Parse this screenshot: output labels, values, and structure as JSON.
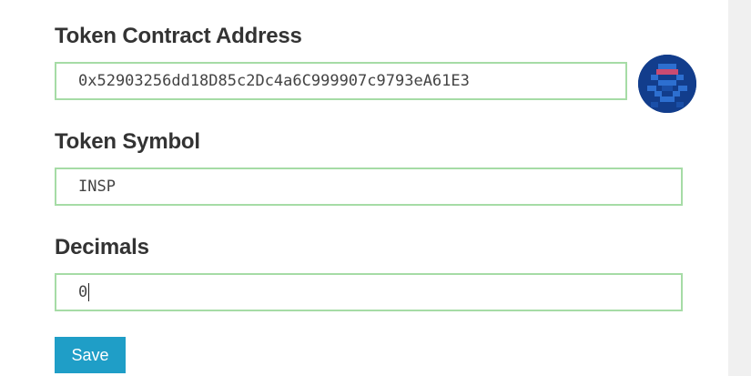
{
  "form": {
    "token_address": {
      "label": "Token Contract Address",
      "value": "0x52903256dd18D85c2Dc4a6C999907c9793eA61E3"
    },
    "token_symbol": {
      "label": "Token Symbol",
      "value": "INSP"
    },
    "decimals": {
      "label": "Decimals",
      "value": "0"
    },
    "save_label": "Save"
  },
  "colors": {
    "field_border": "#a6dca6",
    "button_bg": "#1f9ec7",
    "identicon_bg": "#123d8c",
    "identicon_fg": "#2d6fd0",
    "identicon_accent": "#c94b72"
  },
  "icons": {
    "token_identicon": "blockie-identicon"
  }
}
